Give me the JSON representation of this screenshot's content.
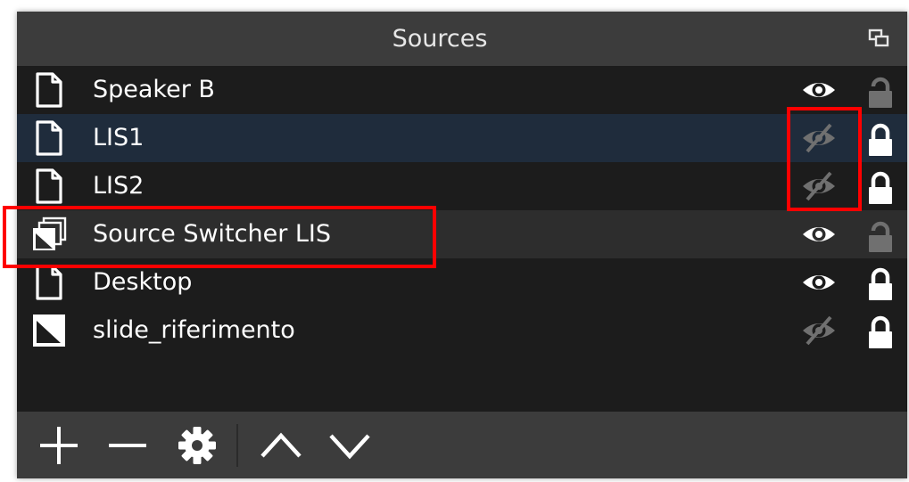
{
  "dock": {
    "title": "Sources",
    "float_icon": "float-dock-icon"
  },
  "colors": {
    "selected_row": "#1f2c3c",
    "alt_row": "#2d2d2d",
    "visible_icon": "#ffffff",
    "hidden_icon": "#707070",
    "locked_icon": "#ffffff",
    "unlocked_icon": "#707070",
    "highlight": "#ff0000"
  },
  "sources": [
    {
      "name": "Speaker B",
      "type_icon": "file-icon",
      "visible": true,
      "locked": false
    },
    {
      "name": "LIS1",
      "type_icon": "file-icon",
      "visible": false,
      "locked": true,
      "selected": true
    },
    {
      "name": "LIS2",
      "type_icon": "file-icon",
      "visible": false,
      "locked": true
    },
    {
      "name": "Source Switcher LIS",
      "type_icon": "source-switcher-icon",
      "visible": true,
      "locked": false
    },
    {
      "name": "Desktop",
      "type_icon": "file-icon",
      "visible": true,
      "locked": true
    },
    {
      "name": "slide_riferimento",
      "type_icon": "image-icon",
      "visible": false,
      "locked": true
    }
  ],
  "toolbar": {
    "buttons": [
      "add-icon",
      "remove-icon",
      "gear-icon",
      "move-up-icon",
      "move-down-icon"
    ]
  }
}
